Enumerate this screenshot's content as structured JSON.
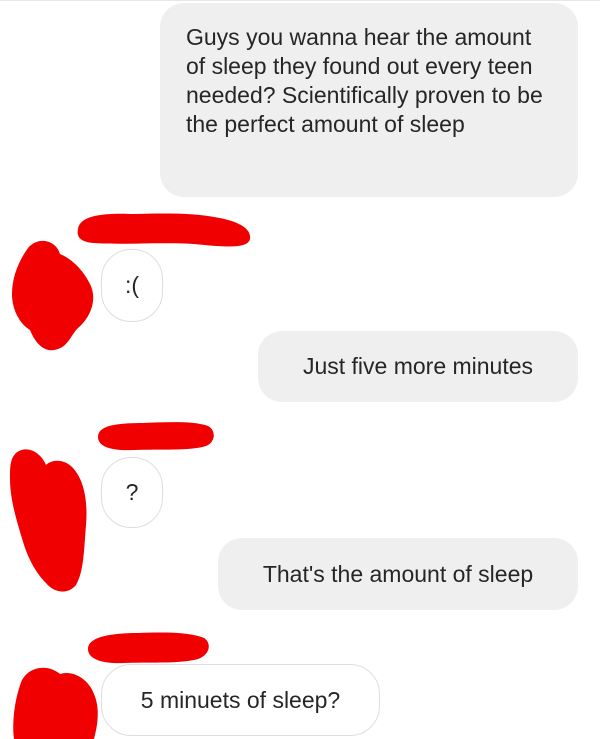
{
  "messages": [
    {
      "id": "m1",
      "sender": "me",
      "text": "Guys you wanna hear the amount of sleep they found out every teen needed? Scientifically proven to be the perfect amount of sleep"
    },
    {
      "id": "m2",
      "sender": "other",
      "text": ":("
    },
    {
      "id": "m3",
      "sender": "me",
      "text": "Just five more minutes"
    },
    {
      "id": "m4",
      "sender": "other",
      "text": "?"
    },
    {
      "id": "m5",
      "sender": "me",
      "text": "That's the amount of sleep"
    },
    {
      "id": "m6",
      "sender": "other",
      "text": "5 minuets of sleep?"
    }
  ],
  "colors": {
    "sent_bubble": "#efeff0",
    "received_bubble_border": "#dedede",
    "text": "#262626",
    "redaction": "#f00000"
  }
}
